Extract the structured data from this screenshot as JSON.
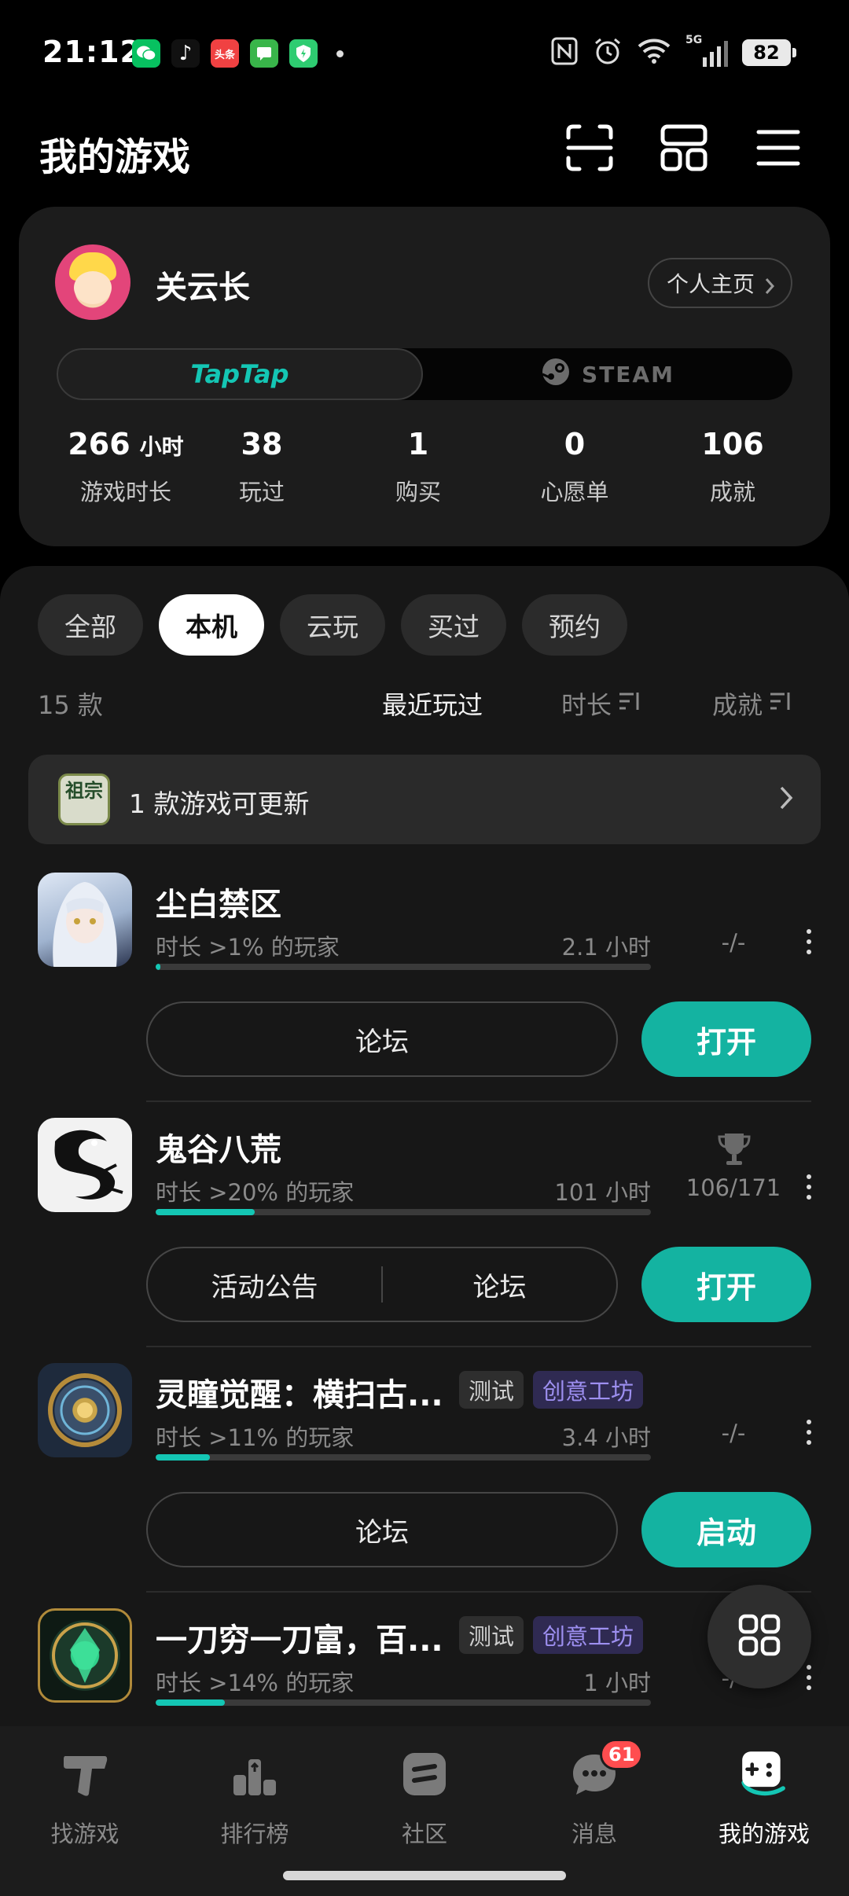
{
  "status_bar": {
    "time": "21:12",
    "apps": [
      {
        "icon": "wechat-icon",
        "color": "#07c160",
        "text": ""
      },
      {
        "icon": "douyin-icon",
        "color": "#111111",
        "text": "♪"
      },
      {
        "icon": "toutiao-icon",
        "color": "#f04142",
        "text": "头条"
      },
      {
        "icon": "chat-app-icon",
        "color": "#39b54a",
        "text": ""
      },
      {
        "icon": "shield-app-icon",
        "color": "#2ecc71",
        "text": ""
      }
    ],
    "network": "5G",
    "battery": "82"
  },
  "header": {
    "title": "我的游戏",
    "scan_icon": "scan-icon",
    "layout_icon": "layout-icon",
    "menu_icon": "menu-icon"
  },
  "profile": {
    "username": "关云长",
    "home_button": "个人主页",
    "platforms": [
      "TapTap",
      "STEAM"
    ],
    "active_platform": "TapTap",
    "stats": [
      {
        "value": "266",
        "unit": "小时",
        "label": "游戏时长"
      },
      {
        "value": "38",
        "unit": "",
        "label": "玩过"
      },
      {
        "value": "1",
        "unit": "",
        "label": "购买"
      },
      {
        "value": "0",
        "unit": "",
        "label": "心愿单"
      },
      {
        "value": "106",
        "unit": "",
        "label": "成就"
      }
    ]
  },
  "filters": {
    "chips": [
      "全部",
      "本机",
      "云玩",
      "买过",
      "预约"
    ],
    "active": "本机"
  },
  "list_meta": {
    "count": "15 款",
    "sort_recent": "最近玩过",
    "sort_duration": "时长",
    "sort_achievement": "成就"
  },
  "update_banner": {
    "icon_text": "祖宗",
    "text": "1 款游戏可更新"
  },
  "games": [
    {
      "name": "尘白禁区",
      "tags": [],
      "percentile": "时长 >1% 的玩家",
      "hours": "2.1 小时",
      "achievements": "-/-",
      "progress": 0.01,
      "buttons": [
        "论坛"
      ],
      "action": "打开"
    },
    {
      "name": "鬼谷八荒",
      "tags": [],
      "percentile": "时长 >20% 的玩家",
      "hours": "101 小时",
      "achievements": "106/171",
      "progress": 0.2,
      "buttons": [
        "活动公告",
        "论坛"
      ],
      "action": "打开"
    },
    {
      "name": "灵瞳觉醒：横扫古...",
      "tags": [
        "测试",
        "创意工坊"
      ],
      "percentile": "时长 >11% 的玩家",
      "hours": "3.4 小时",
      "achievements": "-/-",
      "progress": 0.11,
      "buttons": [
        "论坛"
      ],
      "action": "启动"
    },
    {
      "name": "一刀穷一刀富，百...",
      "tags": [
        "测试",
        "创意工坊"
      ],
      "percentile": "时长 >14% 的玩家",
      "hours": "1 小时",
      "achievements": "-/-",
      "progress": 0.14,
      "buttons": [],
      "action": ""
    }
  ],
  "bottom_nav": [
    {
      "label": "找游戏",
      "icon": "taptap-t-icon"
    },
    {
      "label": "排行榜",
      "icon": "ranking-icon"
    },
    {
      "label": "社区",
      "icon": "community-icon"
    },
    {
      "label": "消息",
      "icon": "message-icon",
      "badge": "61"
    },
    {
      "label": "我的游戏",
      "icon": "gamepad-icon",
      "active": true
    }
  ],
  "colors": {
    "accent": "#14b3a1",
    "background": "#000000",
    "card": "#1c1c1c",
    "workshop_tag": "#9d8ff0"
  }
}
